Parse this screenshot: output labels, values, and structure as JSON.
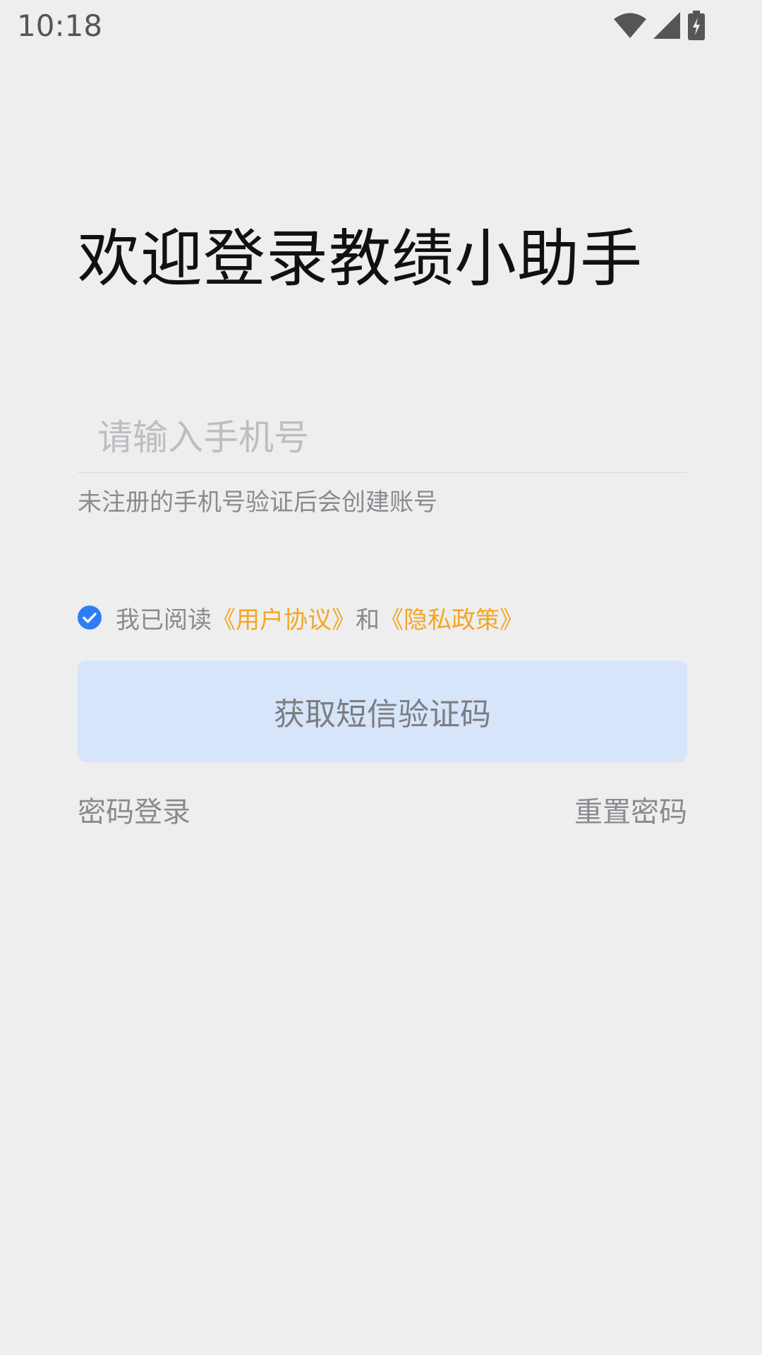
{
  "status_bar": {
    "time": "10:18",
    "icons": [
      "wifi-icon",
      "signal-icon",
      "battery-charging-icon"
    ]
  },
  "title": "欢迎登录教绩小助手",
  "phone_input": {
    "placeholder": "请输入手机号",
    "value": ""
  },
  "hint": "未注册的手机号验证后会创建账号",
  "agreement": {
    "checked": true,
    "prefix": "我已阅读",
    "user_agreement": "《用户协议》",
    "conjunction": "和",
    "privacy_policy": "《隐私政策》"
  },
  "sms_button_label": "获取短信验证码",
  "password_login_label": "密码登录",
  "reset_password_label": "重置密码",
  "colors": {
    "background": "#eeeeef",
    "accent_link": "#f5a623",
    "check_blue": "#2f7df6",
    "button_bg": "#d7e5fb"
  }
}
